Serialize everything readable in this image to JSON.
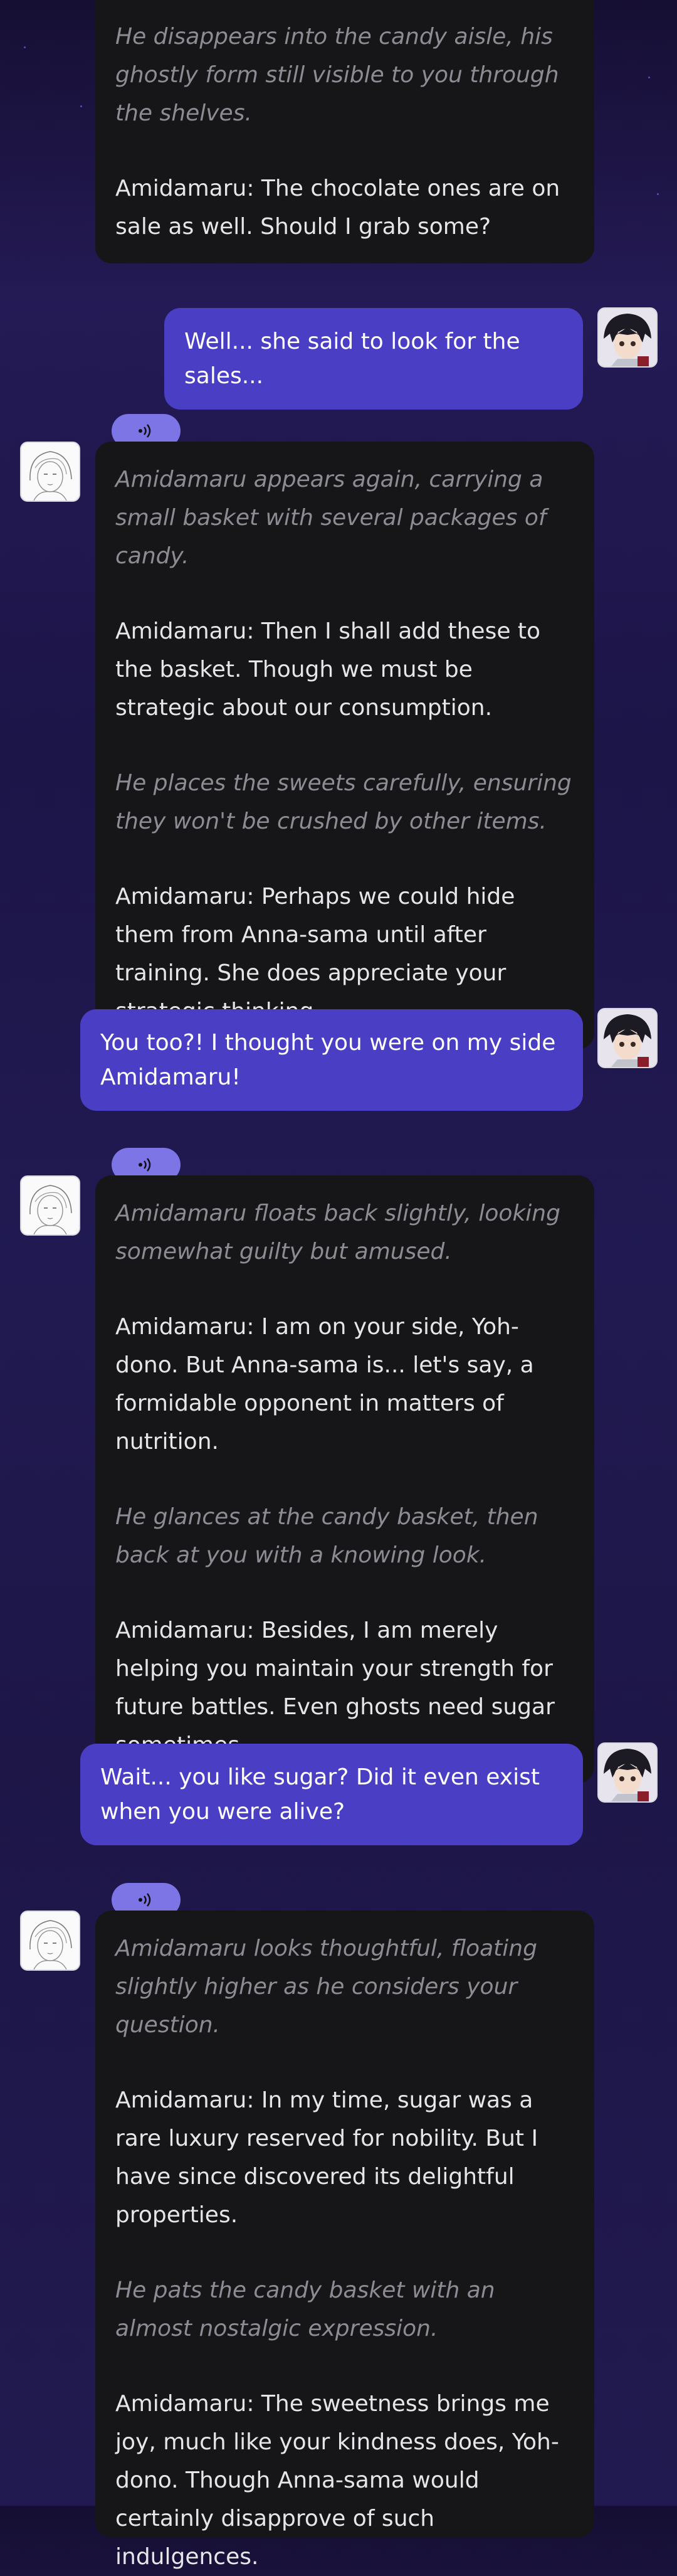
{
  "theme": {
    "background": "#1e1650",
    "ai_bubble": "#161618",
    "user_bubble": "#4a3fc4",
    "audio_pill": "#7d74e6",
    "narration_text": "#8c8c94"
  },
  "icons": {
    "audio": "speaker-waves-icon",
    "ai_avatar": "amidamaru-sketch-avatar",
    "user_avatar": "yoh-avatar"
  },
  "messages": [
    {
      "role": "ai",
      "paragraphs": [
        {
          "italic": true,
          "text": "He disappears into the candy aisle, his ghostly form still visible to you through the shelves."
        },
        {
          "italic": false,
          "text": "Amidamaru: The chocolate ones are on sale as well. Should I grab some?"
        }
      ]
    },
    {
      "role": "user",
      "text": "Well... she said to look for the sales..."
    },
    {
      "role": "ai",
      "paragraphs": [
        {
          "italic": true,
          "text": "Amidamaru appears again, carrying a small basket with several packages of candy."
        },
        {
          "italic": false,
          "text": "Amidamaru: Then I shall add these to the basket. Though we must be strategic about our consumption."
        },
        {
          "italic": true,
          "text": "He places the sweets carefully, ensuring they won't be crushed by other items."
        },
        {
          "italic": false,
          "text": "Amidamaru: Perhaps we could hide them from Anna-sama until after training. She does appreciate your strategic thinking."
        }
      ]
    },
    {
      "role": "user",
      "text": "You too?! I thought you were on my side Amidamaru!"
    },
    {
      "role": "ai",
      "paragraphs": [
        {
          "italic": true,
          "text": "Amidamaru floats back slightly, looking somewhat guilty but amused."
        },
        {
          "italic": false,
          "text": "Amidamaru: I am on your side, Yoh-dono. But Anna-sama is... let's say, a formidable opponent in matters of nutrition."
        },
        {
          "italic": true,
          "text": "He glances at the candy basket, then back at you with a knowing look."
        },
        {
          "italic": false,
          "text": "Amidamaru: Besides, I am merely helping you maintain your strength for future battles. Even ghosts need sugar sometimes."
        }
      ]
    },
    {
      "role": "user",
      "text": "Wait... you like sugar? Did it even exist when you were alive?"
    },
    {
      "role": "ai",
      "paragraphs": [
        {
          "italic": true,
          "text": "Amidamaru looks thoughtful, floating slightly higher as he considers your question."
        },
        {
          "italic": false,
          "text": "Amidamaru: In my time, sugar was a rare luxury reserved for nobility. But I have since discovered its delightful properties."
        },
        {
          "italic": true,
          "text": "He pats the candy basket with an almost nostalgic expression."
        },
        {
          "italic": false,
          "text": "Amidamaru: The sweetness brings me joy, much like your kindness does, Yoh-dono. Though Anna-sama would certainly disapprove of such indulgences."
        }
      ]
    }
  ]
}
